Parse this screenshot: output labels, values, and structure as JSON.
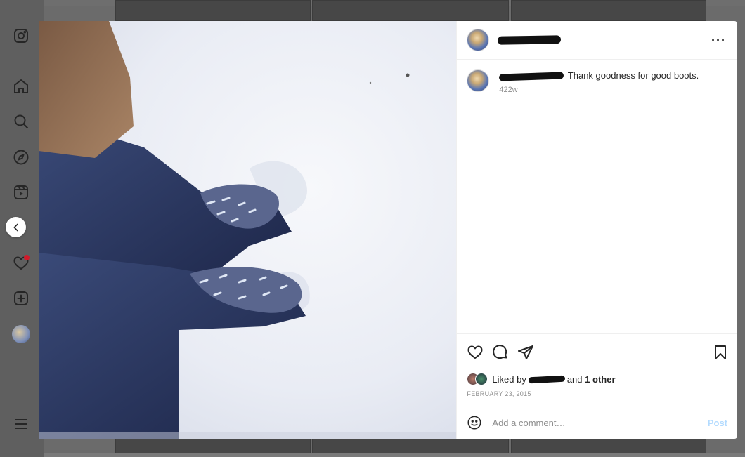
{
  "post": {
    "caption": "Thank goodness for good boots.",
    "time_ago": "422w",
    "date": "FEBRUARY 23, 2015",
    "more_label": "···"
  },
  "likes": {
    "prefix": "Liked by",
    "and": "and",
    "others": "1 other"
  },
  "comment_box": {
    "placeholder": "Add a comment…",
    "post_label": "Post"
  },
  "icons": {
    "sidebar": [
      "instagram-icon",
      "home-icon",
      "search-icon",
      "explore-icon",
      "reels-icon",
      "heart-icon",
      "create-icon",
      "profile-avatar",
      "menu-icon"
    ],
    "actions": [
      "like-icon",
      "comment-icon",
      "share-icon",
      "bookmark-icon"
    ]
  },
  "colors": {
    "post_button": "#b3dbff",
    "notification_dot": "#d11a2a",
    "overlay": "#6b6b6b"
  }
}
